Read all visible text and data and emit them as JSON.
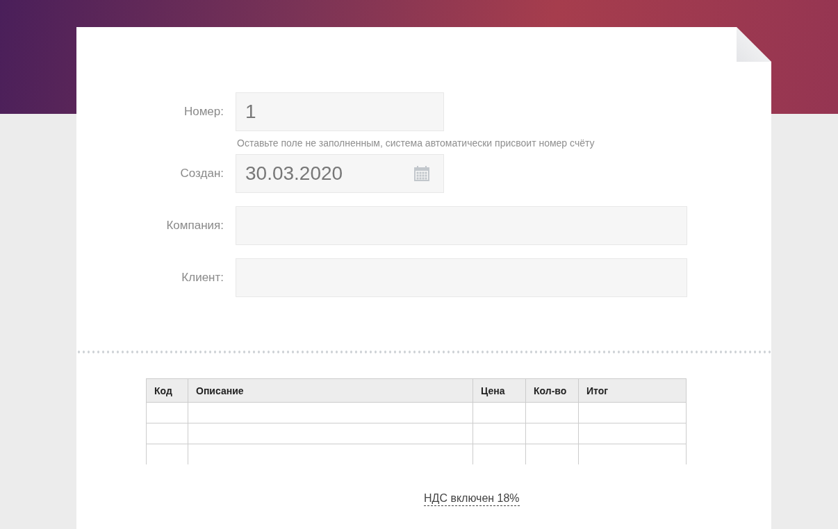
{
  "form": {
    "fields": [
      {
        "label": "Номер:",
        "kind": "number",
        "value": "1",
        "hint": "Оставьте поле не заполненным, система автоматически присвоит номер счёту"
      },
      {
        "label": "Создан:",
        "kind": "date",
        "value": "30.03.2020"
      },
      {
        "label": "Компания:",
        "kind": "text"
      },
      {
        "label": "Клиент:",
        "kind": "text"
      }
    ]
  },
  "items_table": {
    "columns": [
      "Код",
      "Описание",
      "Цена",
      "Кол-во",
      "Итог"
    ],
    "rows": [
      {
        "kind": "empty"
      },
      {
        "kind": "empty"
      },
      {
        "kind": "empty"
      }
    ]
  },
  "vat_link": "НДС включен 18%"
}
